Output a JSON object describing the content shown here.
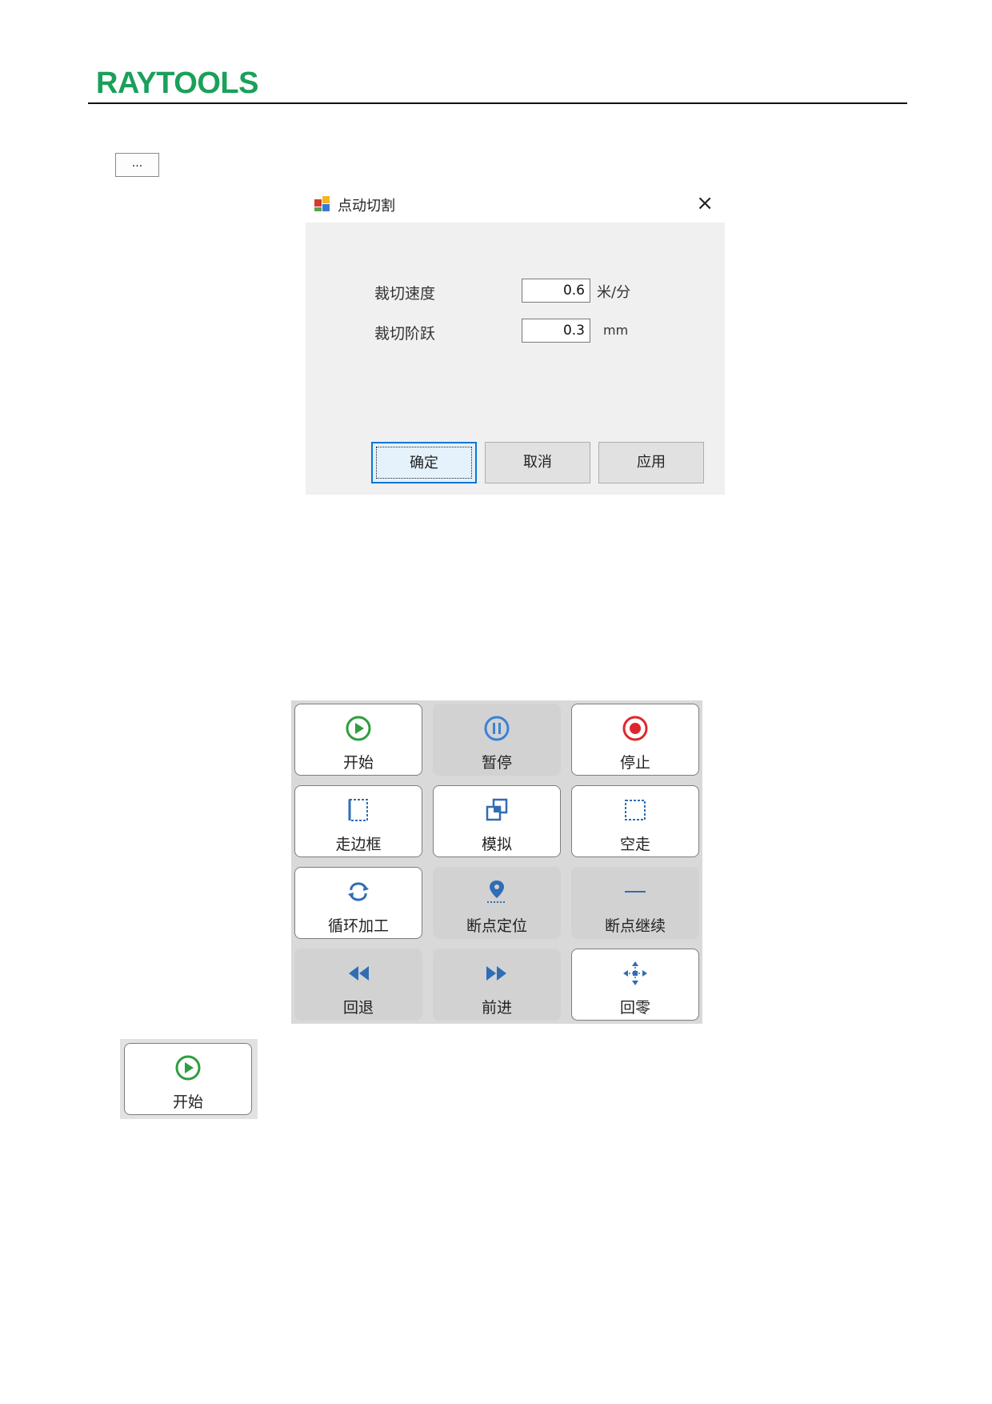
{
  "header": {
    "logo_text": "RAYTOOLS"
  },
  "ellipsis_button": {
    "label": "..."
  },
  "dialog": {
    "title": "点动切割",
    "close_label": "×",
    "fields": [
      {
        "label": "裁切速度",
        "value": "0.6",
        "unit": "米/分"
      },
      {
        "label": "裁切阶跃",
        "value": "0.3",
        "unit": "mm"
      }
    ],
    "buttons": {
      "ok": "确定",
      "cancel": "取消",
      "apply": "应用"
    }
  },
  "control_panel": {
    "buttons": [
      {
        "label": "开始",
        "icon": "play-circle-icon",
        "enabled": true,
        "color": "#2e9e3e"
      },
      {
        "label": "暂停",
        "icon": "pause-circle-icon",
        "enabled": false,
        "color": "#3b82d6"
      },
      {
        "label": "停止",
        "icon": "stop-circle-icon",
        "enabled": true,
        "color": "#e0262d"
      },
      {
        "label": "走边框",
        "icon": "frame-trace-icon",
        "enabled": true,
        "color": "#2f6db5"
      },
      {
        "label": "模拟",
        "icon": "simulate-icon",
        "enabled": true,
        "color": "#2f6db5"
      },
      {
        "label": "空走",
        "icon": "dry-run-icon",
        "enabled": true,
        "color": "#2f6db5"
      },
      {
        "label": "循环加工",
        "icon": "loop-icon",
        "enabled": true,
        "color": "#2f6db5"
      },
      {
        "label": "断点定位",
        "icon": "breakpoint-locate-icon",
        "enabled": false,
        "color": "#2f6db5"
      },
      {
        "label": "断点继续",
        "icon": "breakpoint-continue-icon",
        "enabled": false,
        "color": "#2f6db5"
      },
      {
        "label": "回退",
        "icon": "rewind-icon",
        "enabled": false,
        "color": "#2f6db5"
      },
      {
        "label": "前进",
        "icon": "forward-icon",
        "enabled": false,
        "color": "#2f6db5"
      },
      {
        "label": "回零",
        "icon": "home-zero-icon",
        "enabled": true,
        "color": "#2f6db5"
      }
    ]
  },
  "single_start_button": {
    "label": "开始",
    "icon": "play-circle-icon"
  }
}
